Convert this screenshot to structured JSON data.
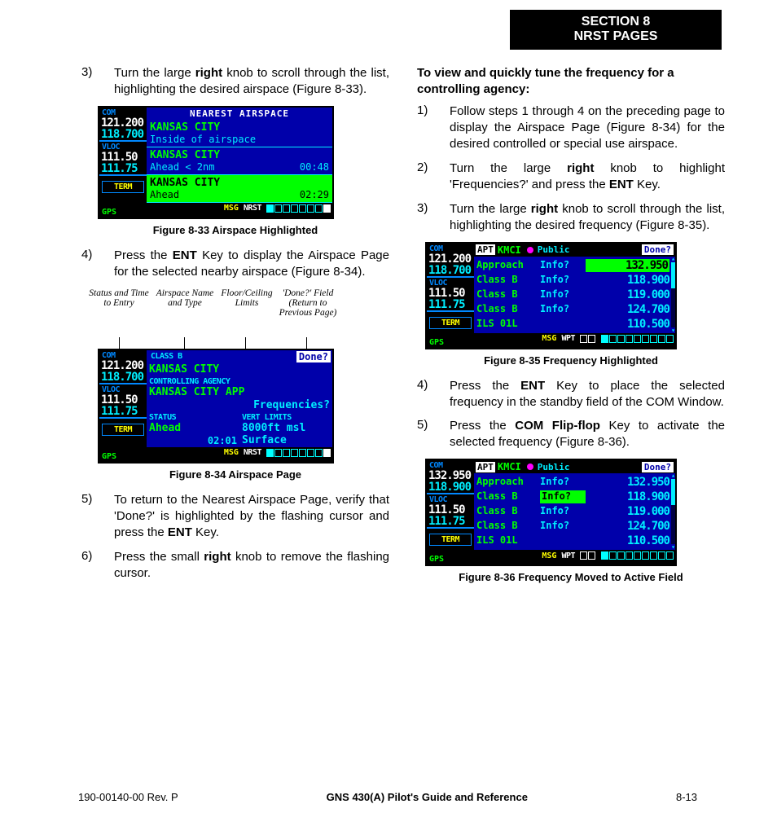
{
  "header": {
    "line1": "SECTION 8",
    "line2": "NRST PAGES"
  },
  "left": {
    "step3": {
      "num": "3)",
      "pre": "Turn the large ",
      "bold": "right",
      "post": " knob to scroll through the list, highlighting the desired airspace (Figure 8-33)."
    },
    "fig33": {
      "caption": "Figure 8-33  Airspace Highlighted",
      "title": "NEAREST AIRSPACE",
      "side": {
        "com": "COM",
        "com_act": "121.200",
        "com_sby": "118.700",
        "vloc": "VLOC",
        "vloc_act": "111.50",
        "vloc_sby": "111.75",
        "term": "TERM",
        "gps": "GPS"
      },
      "rows": [
        {
          "name": "KANSAS CITY",
          "sub": "Inside of airspace",
          "time": "",
          "hl": false
        },
        {
          "name": "KANSAS CITY",
          "sub": "Ahead < 2nm",
          "time": "00:48",
          "hl": false
        },
        {
          "name": "KANSAS CITY",
          "sub": "Ahead",
          "time": "02:29",
          "hl": true
        }
      ],
      "msg": "MSG",
      "tag": "NRST"
    },
    "step4": {
      "num": "4)",
      "pre": "Press the ",
      "bold": "ENT",
      "post": " Key to display the Airspace Page for the selected nearby airspace (Figure 8-34)."
    },
    "callouts": {
      "c1": "Status and Time to Entry",
      "c2": "Airspace Name and Type",
      "c3": "Floor/Ceiling Limits",
      "c4": "'Done?' Field (Return to Previous Page)"
    },
    "fig34": {
      "caption": "Figure 8-34  Airspace Page",
      "side": {
        "com": "COM",
        "com_act": "121.200",
        "com_sby": "118.700",
        "vloc": "VLOC",
        "vloc_act": "111.50",
        "vloc_sby": "111.75",
        "term": "TERM",
        "gps": "GPS"
      },
      "class_lbl": "CLASS B",
      "done": "Done?",
      "name": "KANSAS CITY",
      "agency_lbl": "CONTROLLING AGENCY",
      "agency": "KANSAS CITY APP",
      "freq_prompt": "Frequencies?",
      "status_lbl": "STATUS",
      "vert_lbl": "VERT LIMITS",
      "status": "Ahead",
      "eta": "02:01",
      "vert1": "8000ft msl",
      "vert2": "Surface",
      "msg": "MSG",
      "tag": "NRST"
    },
    "step5": {
      "num": "5)",
      "pre": "To return to the Nearest Airspace Page, verify that 'Done?' is highlighted by the flashing cursor and press the ",
      "bold": "ENT",
      "post": " Key."
    },
    "step6": {
      "num": "6)",
      "pre": "Press the small ",
      "bold": "right",
      "post": " knob to remove the flashing cursor."
    }
  },
  "right": {
    "heading": "To view and quickly tune the frequency for a controlling agency:",
    "step1": {
      "num": "1)",
      "txt": "Follow steps 1 through 4 on the preceding page to display the Airspace Page (Figure 8-34) for the desired controlled or special use airspace."
    },
    "step2": {
      "num": "2)",
      "pre": "Turn the large ",
      "bold": "right",
      "mid": " knob to highlight 'Frequencies?' and press the ",
      "bold2": "ENT",
      "post": " Key."
    },
    "step3": {
      "num": "3)",
      "pre": "Turn the large ",
      "bold": "right",
      "post": " knob to scroll through the list, highlighting the desired frequency (Figure 8-35)."
    },
    "fig35": {
      "caption": "Figure 8-35  Frequency Highlighted",
      "side": {
        "com": "COM",
        "com_act": "121.200",
        "com_sby": "118.700",
        "vloc": "VLOC",
        "vloc_act": "111.50",
        "vloc_sby": "111.75",
        "term": "TERM",
        "gps": "GPS"
      },
      "apt_lbl": "APT",
      "icao": "KMCI",
      "pub": "Public",
      "done": "Done?",
      "rows": [
        {
          "typ": "Approach",
          "inf": "Info?",
          "frq": "132.950",
          "hl": true
        },
        {
          "typ": "Class B",
          "inf": "Info?",
          "frq": "118.900",
          "hl": false
        },
        {
          "typ": "Class B",
          "inf": "Info?",
          "frq": "119.000",
          "hl": false
        },
        {
          "typ": "Class B",
          "inf": "Info?",
          "frq": "124.700",
          "hl": false
        },
        {
          "typ": "ILS 01L",
          "inf": "",
          "frq": "110.500",
          "hl": false
        }
      ],
      "msg": "MSG",
      "tag": "WPT"
    },
    "step4": {
      "num": "4)",
      "pre": "Press the ",
      "bold": "ENT",
      "post": " Key to place the selected frequency in the standby field of the COM Window."
    },
    "step5": {
      "num": "5)",
      "pre": "Press the ",
      "bold": "COM Flip-flop",
      "post": " Key to activate the selected frequency (Figure 8-36)."
    },
    "fig36": {
      "caption": "Figure 8-36  Frequency Moved to Active Field",
      "side": {
        "com": "COM",
        "com_act": "132.950",
        "com_sby": "118.900",
        "vloc": "VLOC",
        "vloc_act": "111.50",
        "vloc_sby": "111.75",
        "term": "TERM",
        "gps": "GPS"
      },
      "apt_lbl": "APT",
      "icao": "KMCI",
      "pub": "Public",
      "done": "Done?",
      "rows": [
        {
          "typ": "Approach",
          "inf": "Info?",
          "frq": "132.950",
          "inf_hl": false
        },
        {
          "typ": "Class B",
          "inf": "Info?",
          "frq": "118.900",
          "inf_hl": true
        },
        {
          "typ": "Class B",
          "inf": "Info?",
          "frq": "119.000",
          "inf_hl": false
        },
        {
          "typ": "Class B",
          "inf": "Info?",
          "frq": "124.700",
          "inf_hl": false
        },
        {
          "typ": "ILS 01L",
          "inf": "",
          "frq": "110.500",
          "inf_hl": false
        }
      ],
      "msg": "MSG",
      "tag": "WPT"
    }
  },
  "footer": {
    "left": "190-00140-00  Rev. P",
    "center": "GNS 430(A) Pilot's Guide and Reference",
    "right": "8-13"
  }
}
